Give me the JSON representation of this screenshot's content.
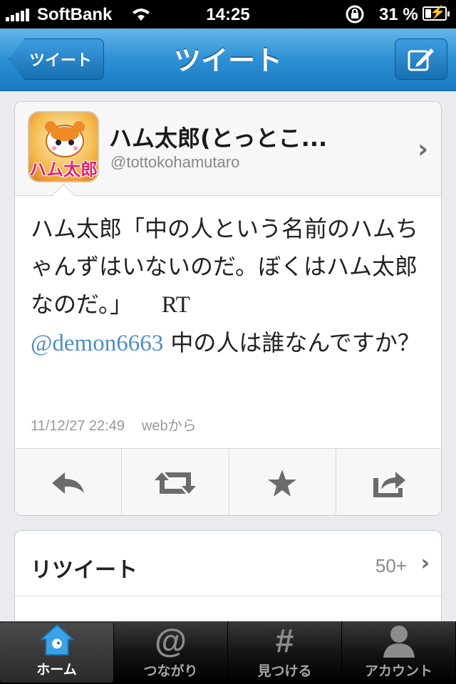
{
  "status_bar": {
    "carrier": "SoftBank",
    "time": "14:25",
    "battery_percent": "31 %",
    "battery_level": 0.31
  },
  "nav": {
    "back_label": "ツイート",
    "title": "ツイート",
    "compose_icon": "compose-icon"
  },
  "tweet": {
    "display_name": "ハム太郎(とっとこ...",
    "handle": "@tottokohamutaro",
    "avatar_text": "ハム太郎",
    "text_main": "ハム太郎「中の人という名前のハムちゃんずはいないのだ。ぼくはハム太郎なのだ。」",
    "rt_label": "RT",
    "mention": "@demon6663",
    "text_after": "中の人は誰なんですか？",
    "timestamp": "11/12/27 22:49",
    "via": "webから",
    "mention_color": "#4a8fc4"
  },
  "actions": [
    "reply-icon",
    "retweet-icon",
    "favorite-icon",
    "share-icon"
  ],
  "list": [
    {
      "label": "リツイート",
      "count": "50+"
    }
  ],
  "tabs": [
    {
      "label": "ホーム",
      "icon": "home-icon",
      "active": true
    },
    {
      "label": "つながり",
      "icon": "at-icon",
      "active": false
    },
    {
      "label": "見つける",
      "icon": "hash-icon",
      "active": false
    },
    {
      "label": "アカウント",
      "icon": "person-icon",
      "active": false
    }
  ]
}
